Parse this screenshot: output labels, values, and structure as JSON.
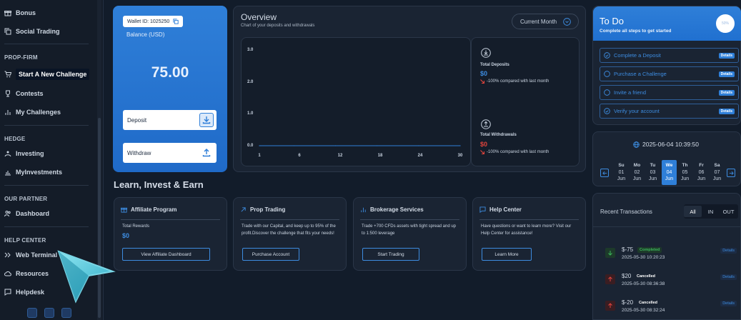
{
  "sidebar": {
    "top_items": [
      {
        "label": "Bonus",
        "icon": "gift-icon"
      },
      {
        "label": "Social Trading",
        "icon": "copy-icon"
      }
    ],
    "sections": [
      {
        "heading": "PROP-FIRM",
        "items": [
          {
            "label": "Start A New Challenge",
            "icon": "cart-icon",
            "highlighted": true
          },
          {
            "label": "Contests",
            "icon": "trophy-icon"
          },
          {
            "label": "My Challenges",
            "icon": "bar-chart-icon"
          }
        ]
      },
      {
        "heading": "HEDGE",
        "items": [
          {
            "label": "Investing",
            "icon": "investing-icon"
          },
          {
            "label": "MyInvestments",
            "icon": "growth-icon"
          }
        ]
      },
      {
        "heading": "OUR PARTNER",
        "items": [
          {
            "label": "Dashboard",
            "icon": "users-icon"
          }
        ]
      },
      {
        "heading": "HELP CENTER",
        "items": [
          {
            "label": "Web Terminal",
            "icon": "terminal-icon"
          },
          {
            "label": "Resources",
            "icon": "cloud-icon"
          },
          {
            "label": "Helpdesk",
            "icon": "chat-icon"
          }
        ]
      }
    ],
    "social_icons": [
      "mail-icon",
      "telegram-icon",
      "youtube-icon"
    ]
  },
  "wallet": {
    "wallet_id": "Wallet ID: 1025250",
    "balance_label": "Balance (USD)",
    "balance": "75.00",
    "deposit_label": "Deposit",
    "withdraw_label": "Withdraw"
  },
  "overview": {
    "title": "Overview",
    "subtitle": "Chart of your deposits and withdrawals",
    "period": "Current Month",
    "total_deposits": {
      "label": "Total Deposits",
      "value": "$0",
      "compare": "-100% compared with last month"
    },
    "total_withdrawals": {
      "label": "Total Withdrawals",
      "value": "$0",
      "compare": "-100% compared with last month"
    }
  },
  "chart_data": {
    "type": "line",
    "x": [
      1,
      6,
      12,
      18,
      24,
      30
    ],
    "series": [
      {
        "values": [
          0,
          0,
          0,
          0,
          0,
          0
        ]
      }
    ],
    "y_ticks": [
      "3.0",
      "2.0",
      "1.0",
      "0.0"
    ],
    "x_ticks": [
      "1",
      "6",
      "12",
      "18",
      "24",
      "30"
    ],
    "xlim": [
      1,
      30
    ],
    "ylim": [
      0,
      3
    ],
    "grid": false,
    "line_color": "#2f7fd8"
  },
  "learn": {
    "title": "Learn, Invest & Earn",
    "cards": [
      {
        "title": "Affiliate Program",
        "icon": "gift-icon",
        "stat_label": "Total Rewards",
        "stat_value": "$0",
        "button": "View Affiliate Dashboard"
      },
      {
        "title": "Prop Trading",
        "icon": "arrow-up-right-icon",
        "text": "Trade with our Capital, and keep up to 95% of the profit.Discover the challenge that fits your needs!",
        "button": "Purchase Account"
      },
      {
        "title": "Brokerage Services",
        "icon": "bar-chart-icon",
        "text": "Trade +700 CFDs assets with tight spread and up to 1:500 leverage",
        "button": "Start Trading"
      },
      {
        "title": "Help Center",
        "icon": "chat-icon",
        "text": "Have questions or want to learn more? Visit our Help Center for assistance!",
        "button": "Learn More"
      }
    ]
  },
  "todo": {
    "title": "To Do",
    "subtitle": "Complete all steps to get started",
    "progress_text": "50%",
    "progress": 0.5,
    "items": [
      {
        "label": "Complete a Deposit",
        "done": true,
        "badge": "Details"
      },
      {
        "label": "Purchase a Challenge",
        "done": false,
        "badge": "Details"
      },
      {
        "label": "Invite a friend",
        "done": false,
        "badge": "Details"
      },
      {
        "label": "Verify your account",
        "done": true,
        "badge": "Details"
      }
    ]
  },
  "calendar": {
    "datetime": "2025-06-04 10:39:50",
    "days": [
      {
        "dow": "Su",
        "date": "01",
        "month": "Jun"
      },
      {
        "dow": "Mo",
        "date": "02",
        "month": "Jun"
      },
      {
        "dow": "Tu",
        "date": "03",
        "month": "Jun"
      },
      {
        "dow": "We",
        "date": "04",
        "month": "Jun",
        "selected": true
      },
      {
        "dow": "Th",
        "date": "05",
        "month": "Jun"
      },
      {
        "dow": "Fr",
        "date": "06",
        "month": "Jun"
      },
      {
        "dow": "Sa",
        "date": "07",
        "month": "Jun"
      }
    ]
  },
  "transactions": {
    "title": "Recent Transactions",
    "tabs": [
      "All",
      "IN",
      "OUT"
    ],
    "active_tab": "All",
    "rows": [
      {
        "amount": "$-75",
        "status": "Completed",
        "date": "2025-05-30 10:20:23",
        "direction": "in",
        "details": "Details"
      },
      {
        "amount": "$20",
        "status": "Cancelled",
        "date": "2025-05-30 08:36:38",
        "direction": "out",
        "details": "Details"
      },
      {
        "amount": "$-20",
        "status": "Cancelled",
        "date": "2025-05-30 08:32:24",
        "direction": "out",
        "details": "Details"
      }
    ]
  },
  "colors": {
    "accent": "#2f7fd8",
    "background": "#121c2a",
    "panel": "#1a2433",
    "negative": "#e0443c",
    "positive": "#3bb55a"
  }
}
